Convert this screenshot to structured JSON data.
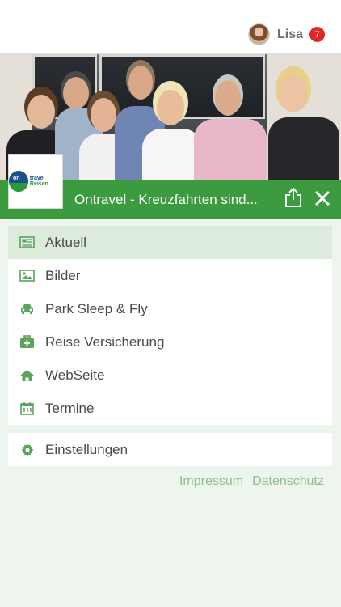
{
  "user": {
    "name": "Lisa",
    "notification_count": "7"
  },
  "header": {
    "title": "Ontravel  - Kreuzfahrten sind..."
  },
  "logo": {
    "mark": "on",
    "text_blue": "travel",
    "text_green": "Reisen"
  },
  "menu": {
    "items": [
      {
        "label": "Aktuell",
        "icon": "newspaper-icon",
        "active": true
      },
      {
        "label": "Bilder",
        "icon": "image-icon"
      },
      {
        "label": "Park Sleep & Fly",
        "icon": "car-icon"
      },
      {
        "label": "Reise Versicherung",
        "icon": "medical-kit-icon"
      },
      {
        "label": "WebSeite",
        "icon": "home-icon"
      },
      {
        "label": "Termine",
        "icon": "calendar-icon"
      }
    ],
    "settings": {
      "label": "Einstellungen",
      "icon": "gear-icon"
    }
  },
  "footer": {
    "impressum": "Impressum",
    "datenschutz": "Datenschutz"
  },
  "colors": {
    "accent": "#3c9b3f",
    "icon": "#5aa55c",
    "badge": "#e0282b",
    "active_bg": "#dcebdc",
    "link": "#8bc28c"
  }
}
